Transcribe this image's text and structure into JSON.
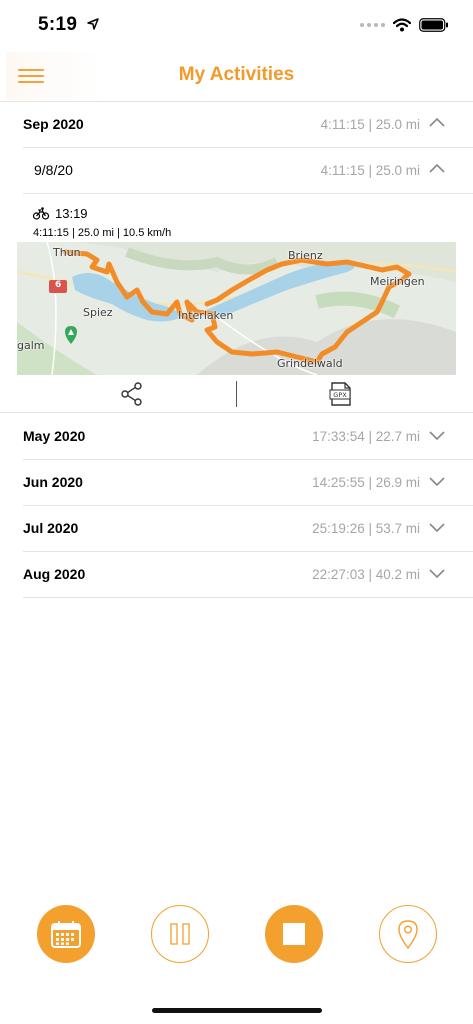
{
  "status": {
    "time": "5:19"
  },
  "header": {
    "title": "My Activities"
  },
  "months": [
    {
      "label": "Sep 2020",
      "summary": "4:11:15 | 25.0 mi",
      "expanded": true
    },
    {
      "label": "May 2020",
      "summary": "17:33:54 | 22.7 mi",
      "expanded": false
    },
    {
      "label": "Jun 2020",
      "summary": "14:25:55 | 26.9 mi",
      "expanded": false
    },
    {
      "label": "Jul 2020",
      "summary": "25:19:26 | 53.7 mi",
      "expanded": false
    },
    {
      "label": "Aug 2020",
      "summary": "22:27:03 | 40.2 mi",
      "expanded": false
    }
  ],
  "day": {
    "label": "9/8/20",
    "summary": "4:11:15 | 25.0 mi"
  },
  "activity": {
    "icon": "bicycle-icon",
    "time": "13:19",
    "stats": "4:11:15 | 25.0 mi | 10.5 km/h"
  },
  "map": {
    "labels": [
      "Thun",
      "Brienz",
      "Meiringen",
      "Spiez",
      "Interlaken",
      "Grindelwald",
      "galm"
    ],
    "road_number": "6",
    "route_color": "#f28c28",
    "lake_color": "#a8d2e8"
  },
  "actions": {
    "share_icon": "share-icon",
    "gpx_icon": "gpx-file-icon",
    "gpx_text": "GPX"
  },
  "bottom_bar": [
    {
      "icon": "calendar-icon",
      "style": "filled"
    },
    {
      "icon": "pause-icon",
      "style": "outline"
    },
    {
      "icon": "stop-icon",
      "style": "filled"
    },
    {
      "icon": "location-pin-icon",
      "style": "outline"
    }
  ],
  "colors": {
    "accent": "#f4a02f",
    "muted_text": "#a6a6a6",
    "divider": "#e3e3e3"
  }
}
